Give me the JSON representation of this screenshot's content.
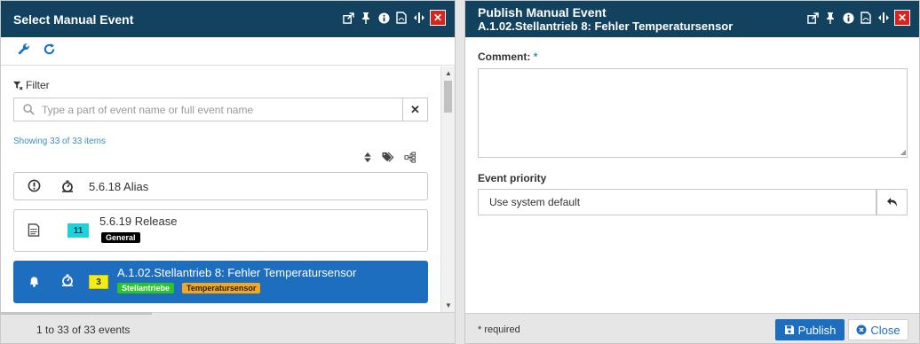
{
  "left": {
    "title": "Select Manual Event",
    "filter_label": "Filter",
    "search_placeholder": "Type a part of event name or full event name",
    "showing": "Showing 33 of 33 items",
    "items": [
      {
        "name": "5.6.18 Alias"
      },
      {
        "name": "5.6.19 Release",
        "count": "11",
        "tags": [
          "General"
        ]
      },
      {
        "name": "A.1.02.Stellantrieb 8: Fehler Temperatursensor",
        "count": "3",
        "tags": [
          "Stellantriebe",
          "Temperatursensor"
        ],
        "selected": true
      }
    ],
    "footer": "1 to 33 of 33 events"
  },
  "right": {
    "title": "Publish Manual Event",
    "subtitle": "A.1.02.Stellantrieb 8: Fehler Temperatursensor",
    "comment_label": "Comment:",
    "required_marker": "*",
    "priority_label": "Event priority",
    "priority_value": "Use system default",
    "required_note": "* required",
    "publish_label": "Publish",
    "close_label": "Close"
  },
  "colors": {
    "titlebar": "#13425f",
    "accent": "#1e6ebf",
    "close_red": "#d9231f",
    "count_cyan": "#1fd1d9",
    "count_yellow": "#f2ec18",
    "tag_green": "#2bc42b",
    "tag_orange": "#f5a81c"
  },
  "icons": {
    "titlebar": [
      "popout-icon",
      "pin-icon",
      "info-icon",
      "pdf-icon",
      "resize-icon",
      "close-icon"
    ],
    "toolbar": [
      "wrench-icon",
      "refresh-icon"
    ],
    "sort": [
      "sort-icon",
      "tags-icon",
      "hierarchy-icon"
    ]
  }
}
